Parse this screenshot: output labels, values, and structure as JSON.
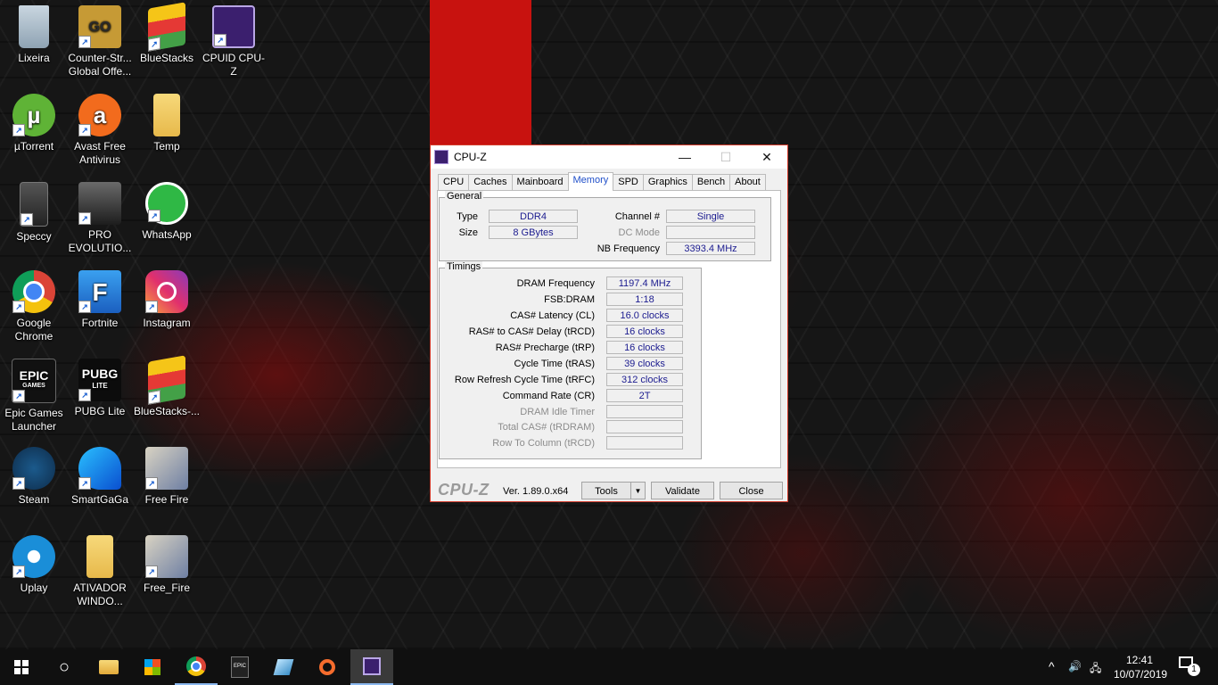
{
  "desktop": {
    "icons": [
      {
        "label": "Lixeira"
      },
      {
        "label": "Counter-Str... Global Offe..."
      },
      {
        "label": "BlueStacks"
      },
      {
        "label": "CPUID CPU-Z"
      },
      {
        "label": "µTorrent"
      },
      {
        "label": "Avast Free Antivirus"
      },
      {
        "label": "Temp"
      },
      {
        "label": "Speccy"
      },
      {
        "label": "PRO EVOLUTIO..."
      },
      {
        "label": "WhatsApp"
      },
      {
        "label": "Google Chrome"
      },
      {
        "label": "Fortnite"
      },
      {
        "label": "Instagram"
      },
      {
        "label": "Epic Games Launcher"
      },
      {
        "label": "PUBG Lite"
      },
      {
        "label": "BlueStacks-..."
      },
      {
        "label": "Steam"
      },
      {
        "label": "SmartGaGa"
      },
      {
        "label": "Free Fire"
      },
      {
        "label": "Uplay"
      },
      {
        "label": "ATIVADOR WINDO..."
      },
      {
        "label": "Free_Fire"
      }
    ],
    "icon_glyphs": {
      "go": "GO",
      "avast": "a",
      "fortnite": "F",
      "epic": "EPIC",
      "epic_sub": "GAMES",
      "pubg": "PUBG",
      "pubg_sub": "LITE"
    }
  },
  "window": {
    "title": "CPU-Z",
    "minimize_glyph": "—",
    "maximize_glyph": "☐",
    "close_glyph": "✕",
    "tabs": [
      {
        "label": "CPU"
      },
      {
        "label": "Caches"
      },
      {
        "label": "Mainboard"
      },
      {
        "label": "Memory"
      },
      {
        "label": "SPD"
      },
      {
        "label": "Graphics"
      },
      {
        "label": "Bench"
      },
      {
        "label": "About"
      }
    ],
    "active_tab": "Memory",
    "general": {
      "title": "General",
      "type_label": "Type",
      "type_value": "DDR4",
      "size_label": "Size",
      "size_value": "8 GBytes",
      "channel_label": "Channel #",
      "channel_value": "Single",
      "dc_mode_label": "DC Mode",
      "dc_mode_value": "",
      "nb_freq_label": "NB Frequency",
      "nb_freq_value": "3393.4 MHz"
    },
    "timings": {
      "title": "Timings",
      "rows": [
        {
          "label": "DRAM Frequency",
          "value": "1197.4 MHz"
        },
        {
          "label": "FSB:DRAM",
          "value": "1:18"
        },
        {
          "label": "CAS# Latency (CL)",
          "value": "16.0 clocks"
        },
        {
          "label": "RAS# to CAS# Delay (tRCD)",
          "value": "16 clocks"
        },
        {
          "label": "RAS# Precharge (tRP)",
          "value": "16 clocks"
        },
        {
          "label": "Cycle Time (tRAS)",
          "value": "39 clocks"
        },
        {
          "label": "Row Refresh Cycle Time (tRFC)",
          "value": "312 clocks"
        },
        {
          "label": "Command Rate (CR)",
          "value": "2T"
        },
        {
          "label": "DRAM Idle Timer",
          "value": ""
        },
        {
          "label": "Total CAS# (tRDRAM)",
          "value": ""
        },
        {
          "label": "Row To Column (tRCD)",
          "value": ""
        }
      ]
    },
    "footer": {
      "brand": "CPU-Z",
      "version": "Ver. 1.89.0.x64",
      "tools_label": "Tools",
      "tools_arrow": "▼",
      "validate_label": "Validate",
      "close_label": "Close"
    }
  },
  "taskbar": {
    "search_glyph": "○",
    "epic_glyph": "EPIC",
    "tray": {
      "chevron": "^",
      "volume": "🔊",
      "network": "🖧",
      "time": "12:41",
      "date": "10/07/2019",
      "notification_count": "1"
    }
  }
}
